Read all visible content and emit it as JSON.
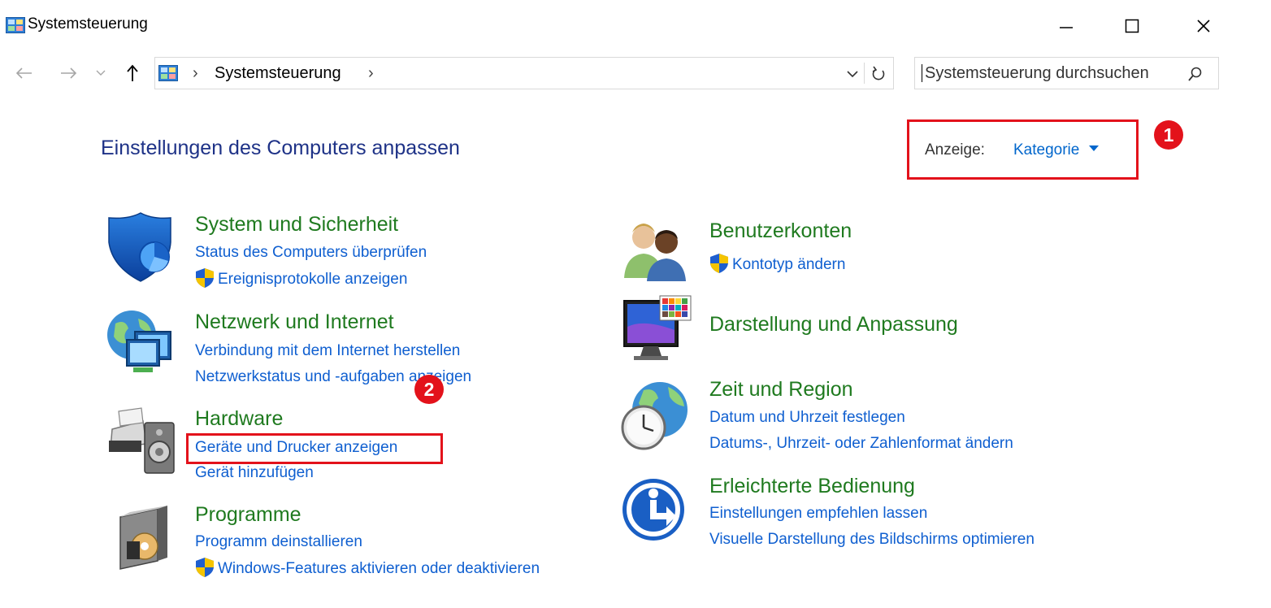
{
  "window": {
    "title": "Systemsteuerung",
    "minimize_glyph": "—",
    "maximize_glyph": "☐",
    "close_glyph": "✕"
  },
  "address_bar": {
    "path": [
      "Systemsteuerung"
    ],
    "separator": "›",
    "search_placeholder": "Systemsteuerung durchsuchen"
  },
  "header": {
    "title": "Einstellungen des Computers anpassen",
    "view_label": "Anzeige:",
    "view_value": "Kategorie"
  },
  "annotations": {
    "badge1": "1",
    "badge2": "2"
  },
  "categories_left": [
    {
      "title": "System und Sicherheit",
      "links": [
        "Status des Computers überprüfen",
        "Ereignisprotokolle anzeigen"
      ]
    },
    {
      "title": "Netzwerk und Internet",
      "links": [
        "Verbindung mit dem Internet herstellen",
        "Netzwerkstatus und -aufgaben anzeigen"
      ]
    },
    {
      "title": "Hardware",
      "links": [
        "Geräte und Drucker anzeigen",
        "Gerät hinzufügen"
      ]
    },
    {
      "title": "Programme",
      "links": [
        "Programm deinstallieren",
        "Windows-Features aktivieren oder deaktivieren"
      ]
    }
  ],
  "categories_right": [
    {
      "title": "Benutzerkonten",
      "links": [
        "Kontotyp ändern"
      ]
    },
    {
      "title": "Darstellung und Anpassung",
      "links": []
    },
    {
      "title": "Zeit und Region",
      "links": [
        "Datum und Uhrzeit festlegen",
        "Datums-, Uhrzeit- oder Zahlenformat ändern"
      ]
    },
    {
      "title": "Erleichterte Bedienung",
      "links": [
        "Einstellungen empfehlen lassen",
        "Visuelle Darstellung des Bildschirms optimieren"
      ]
    }
  ],
  "colors": {
    "title_green": "#1f7a1f",
    "link_blue": "#0f5fd0",
    "header_blue": "#1e3287",
    "annotation_red": "#e3121b"
  }
}
